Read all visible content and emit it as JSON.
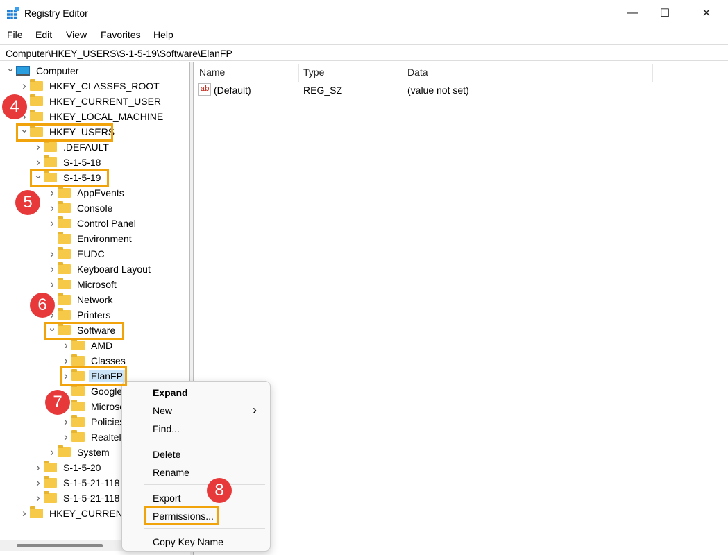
{
  "window": {
    "title": "Registry Editor",
    "minimize": "—",
    "maximize": "☐",
    "close": "✕"
  },
  "menu": [
    "File",
    "Edit",
    "View",
    "Favorites",
    "Help"
  ],
  "address": "Computer\\HKEY_USERS\\S-1-5-19\\Software\\ElanFP",
  "tree": [
    {
      "label": "Computer",
      "level": 0,
      "chev": "open",
      "icon": "computer"
    },
    {
      "label": "HKEY_CLASSES_ROOT",
      "level": 1,
      "chev": "closed"
    },
    {
      "label": "HKEY_CURRENT_USER",
      "level": 1,
      "chev": "closed"
    },
    {
      "label": "HKEY_LOCAL_MACHINE",
      "level": 1,
      "chev": "closed"
    },
    {
      "label": "HKEY_USERS",
      "level": 1,
      "chev": "open"
    },
    {
      "label": ".DEFAULT",
      "level": 2,
      "chev": "closed"
    },
    {
      "label": "S-1-5-18",
      "level": 2,
      "chev": "closed"
    },
    {
      "label": "S-1-5-19",
      "level": 2,
      "chev": "open"
    },
    {
      "label": "AppEvents",
      "level": 3,
      "chev": "closed"
    },
    {
      "label": "Console",
      "level": 3,
      "chev": "closed"
    },
    {
      "label": "Control Panel",
      "level": 3,
      "chev": "closed"
    },
    {
      "label": "Environment",
      "level": 3,
      "chev": "none"
    },
    {
      "label": "EUDC",
      "level": 3,
      "chev": "closed"
    },
    {
      "label": "Keyboard Layout",
      "level": 3,
      "chev": "closed"
    },
    {
      "label": "Microsoft",
      "level": 3,
      "chev": "closed"
    },
    {
      "label": "Network",
      "level": 3,
      "chev": "closed"
    },
    {
      "label": "Printers",
      "level": 3,
      "chev": "closed"
    },
    {
      "label": "Software",
      "level": 3,
      "chev": "open"
    },
    {
      "label": "AMD",
      "level": 4,
      "chev": "closed"
    },
    {
      "label": "Classes",
      "level": 4,
      "chev": "closed"
    },
    {
      "label": "ElanFP",
      "level": 4,
      "chev": "closed",
      "selected": true
    },
    {
      "label": "Google",
      "level": 4,
      "chev": "none"
    },
    {
      "label": "Microsoft",
      "level": 4,
      "chev": "none"
    },
    {
      "label": "Policies",
      "level": 4,
      "chev": "closed"
    },
    {
      "label": "Realtek",
      "level": 4,
      "chev": "closed"
    },
    {
      "label": "System",
      "level": 3,
      "chev": "closed"
    },
    {
      "label": "S-1-5-20",
      "level": 2,
      "chev": "closed"
    },
    {
      "label": "S-1-5-21-118",
      "level": 2,
      "chev": "closed"
    },
    {
      "label": "S-1-5-21-118",
      "level": 2,
      "chev": "closed"
    },
    {
      "label": "HKEY_CURRENT_CONFIG",
      "level": 1,
      "chev": "closed"
    }
  ],
  "list": {
    "columns": [
      "Name",
      "Type",
      "Data"
    ],
    "rows": [
      {
        "name": "(Default)",
        "type": "REG_SZ",
        "data": "(value not set)",
        "icon": "ab"
      }
    ]
  },
  "context_menu": {
    "items": [
      "Expand",
      "New",
      "Find...",
      "Delete",
      "Rename",
      "Export",
      "Permissions...",
      "Copy Key Name"
    ],
    "submenu_arrow": "›"
  },
  "badges": [
    "4",
    "5",
    "6",
    "7",
    "8"
  ],
  "colors": {
    "highlight": "#f0a30a",
    "badge": "#e8393a",
    "selection": "#cce4f7"
  }
}
